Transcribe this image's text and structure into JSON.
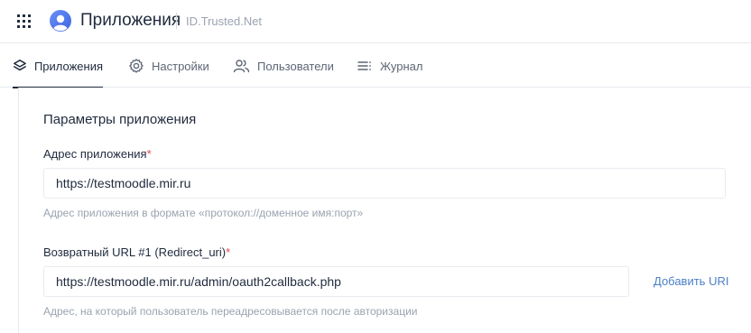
{
  "header": {
    "title": "Приложения",
    "org": "ID.Trusted.Net"
  },
  "tabs": [
    {
      "label": "Приложения",
      "icon": "layers-icon",
      "active": true
    },
    {
      "label": "Настройки",
      "icon": "gear-icon",
      "active": false
    },
    {
      "label": "Пользователи",
      "icon": "users-icon",
      "active": false
    },
    {
      "label": "Журнал",
      "icon": "list-icon",
      "active": false
    }
  ],
  "section": {
    "title": "Параметры приложения"
  },
  "fields": {
    "app_address": {
      "label": "Адрес приложения",
      "required_mark": "*",
      "value": "https://testmoodle.mir.ru",
      "hint": "Адрес приложения в формате «протокол://доменное имя:порт»"
    },
    "redirect_uri": {
      "label": "Возвратный URL #1 (Redirect_uri)",
      "required_mark": "*",
      "value": "https://testmoodle.mir.ru/admin/oauth2callback.php",
      "hint": "Адрес, на который пользователь переадресовывается после авторизации",
      "add_label": "Добавить URI"
    }
  },
  "colors": {
    "text": "#1f2a3d",
    "muted": "#9aa3b0",
    "accent_link": "#4a7fc4",
    "required": "#e5484d",
    "logo_blue": "#4f7df3"
  }
}
